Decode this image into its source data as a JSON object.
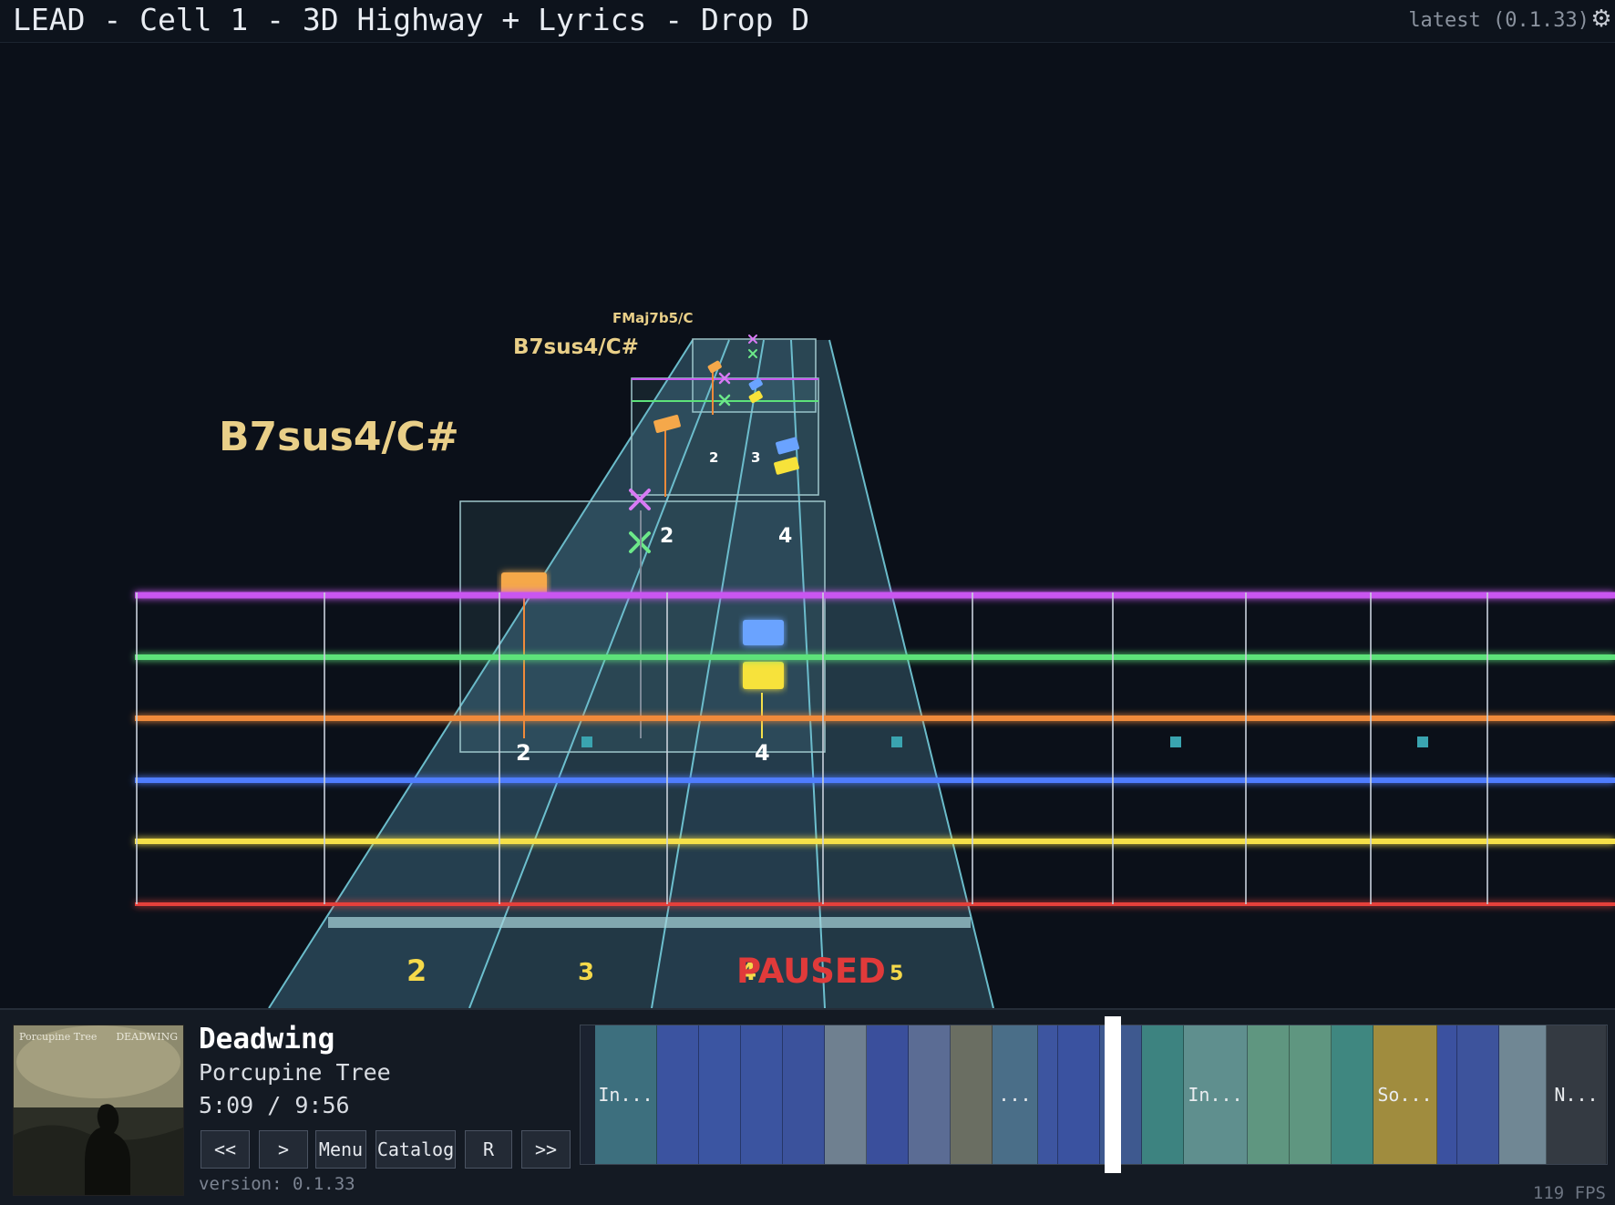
{
  "window": {
    "title": "LEAD - Cell 1 - 3D Highway + Lyrics - Drop D",
    "version_tag": "latest (0.1.33)",
    "settings_icon": "gear-icon"
  },
  "highway": {
    "chords": [
      {
        "name": "B7sus4/C#",
        "size": "large"
      },
      {
        "name": "B7sus4/C#",
        "size": "medium"
      },
      {
        "name": "FMaj7b5/C",
        "size": "small"
      }
    ],
    "string_colors": [
      "#c957f0",
      "#5de27a",
      "#f08a3a",
      "#4f7dff",
      "#f5e04a",
      "#e5413a"
    ],
    "note_numbers": [
      "2",
      "4",
      "2",
      "4",
      "2",
      "3"
    ],
    "fret_numbers": [
      "2",
      "3",
      "4",
      "5"
    ],
    "status": "PAUSED"
  },
  "player": {
    "title": "Deadwing",
    "artist": "Porcupine Tree",
    "time": "5:09 / 9:56",
    "version_line": "version: 0.1.33",
    "fps": "119 FPS",
    "buttons": {
      "rewind": "<<",
      "play": ">",
      "menu": "Menu",
      "catalog": "Catalog",
      "r": "R",
      "forward": ">>"
    },
    "cover_text": {
      "left": "Porcupine Tree",
      "right": "DEADWING"
    },
    "sections": [
      {
        "label": "In...",
        "color": "#3d6f7e"
      },
      {
        "label": "",
        "color": "#3b53a0"
      },
      {
        "label": "",
        "color": "#3b55a2"
      },
      {
        "label": "",
        "color": "#3b54a0"
      },
      {
        "label": "",
        "color": "#3b529c"
      },
      {
        "label": "",
        "color": "#6f8090"
      },
      {
        "label": "",
        "color": "#3a4f9c"
      },
      {
        "label": "",
        "color": "#5b6c94"
      },
      {
        "label": "",
        "color": "#6a6e62"
      },
      {
        "label": "...",
        "color": "#4a6e88"
      },
      {
        "label": "",
        "color": "#3d55a0"
      },
      {
        "label": "",
        "color": "#3a52a0"
      },
      {
        "label": "",
        "color": "#3e598f"
      },
      {
        "label": "",
        "color": "#3d8380"
      },
      {
        "label": "In...",
        "color": "#5f8f8e"
      },
      {
        "label": "",
        "color": "#5f9680"
      },
      {
        "label": "",
        "color": "#5f9680"
      },
      {
        "label": "",
        "color": "#3f8780"
      },
      {
        "label": "So...",
        "color": "#a08c3e"
      },
      {
        "label": "",
        "color": "#3b51a0"
      },
      {
        "label": "",
        "color": "#3d539c"
      },
      {
        "label": "",
        "color": "#708794"
      },
      {
        "label": "N...",
        "color": "#343a42"
      }
    ]
  }
}
